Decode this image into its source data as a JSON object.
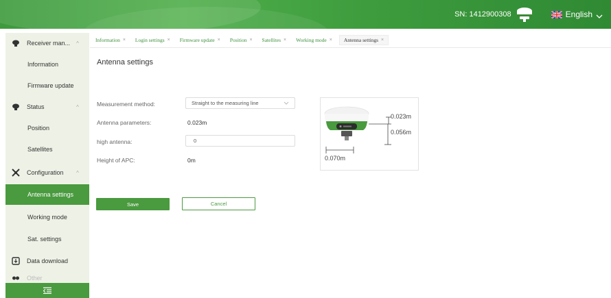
{
  "header": {
    "sn_text": "SN: 1412900308",
    "language": "English",
    "colors": {
      "primary": "#4a9a3f",
      "header_gradient_start": "#3d9a3d",
      "header_gradient_end": "#2f8a33"
    },
    "icons": {
      "device": "gnss-receiver-icon",
      "flag": "uk-flag-icon",
      "dropdown": "chevron-down-icon"
    }
  },
  "sidebar": {
    "groups": {
      "receiver": {
        "label": "Receiver man...",
        "icon": "receiver-icon"
      },
      "status": {
        "label": "Status",
        "icon": "status-icon"
      },
      "configuration": {
        "label": "Configuration",
        "icon": "satellite-icon"
      },
      "download": {
        "label": "Data download",
        "icon": "download-icon"
      },
      "other": {
        "label": "Other",
        "icon": "other-icon"
      }
    },
    "items": {
      "information": "Information",
      "firmware_update": "Firmware update",
      "position": "Position",
      "satellites": "Satellites",
      "antenna_settings": "Antenna settings",
      "working_mode": "Working mode",
      "sat_settings": "Sat. settings"
    },
    "active_item": "Antenna settings",
    "collapse_icon": "menu-collapse-icon"
  },
  "tabs": [
    {
      "label": "Information"
    },
    {
      "label": "Login settings"
    },
    {
      "label": "Firmware update"
    },
    {
      "label": "Position"
    },
    {
      "label": "Satellites"
    },
    {
      "label": "Working mode"
    },
    {
      "label": "Antenna settings",
      "active": true
    }
  ],
  "tab_close": "×",
  "page": {
    "title": "Antenna settings",
    "measurement_method": {
      "label": "Measurement method:",
      "value": "Straight to the measuring line"
    },
    "antenna_parameters": {
      "label": "Antenna parameters:",
      "value": "0.023m"
    },
    "high_antenna": {
      "label": "high antenna:",
      "value": "0"
    },
    "height_apc": {
      "label": "Height of APC:",
      "value": "0m"
    },
    "save_label": "Save",
    "cancel_label": "Cancel"
  },
  "antenna_diagram": {
    "dim_top": "0.023m",
    "dim_height": "0.056m",
    "dim_width": "0.070m"
  }
}
